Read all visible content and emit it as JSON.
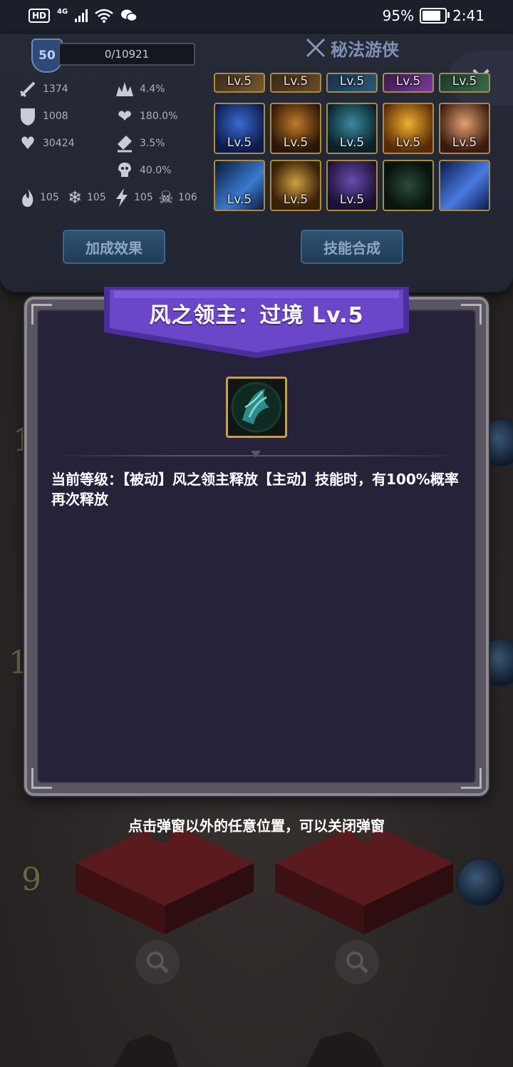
{
  "status_bar": {
    "hd": "HD",
    "signal": "4G",
    "battery_percent": "95%",
    "battery_level": 0.95,
    "time": "2:41"
  },
  "character_panel": {
    "level": "50",
    "xp": "0/10921",
    "class_name": "秘法游侠",
    "stats": {
      "attack": "1374",
      "defense": "1008",
      "hp": "30424",
      "crit_rate": "4.4%",
      "crit_damage": "180.0%",
      "dodge": "3.5%",
      "skill_value": "40.0%",
      "fire": "105",
      "ice": "105",
      "lightning": "105",
      "poison": "106"
    },
    "skill_level_label": "Lv.5",
    "buttons": {
      "bonus": "加成效果",
      "synthesis": "技能合成"
    }
  },
  "popup": {
    "title": "风之领主：过境 Lv.5",
    "description": "当前等级：【被动】风之领主释放【主动】技能时，有100%概率再次释放",
    "close_hint": "点击弹窗以外的任意位置，可以关闭弹窗"
  },
  "background": {
    "numbers": [
      "1",
      "1",
      "9"
    ]
  },
  "colors": {
    "banner_purple": "#6a46c8",
    "skill_border": "#a88b44",
    "panel_button": "#2f5274"
  }
}
